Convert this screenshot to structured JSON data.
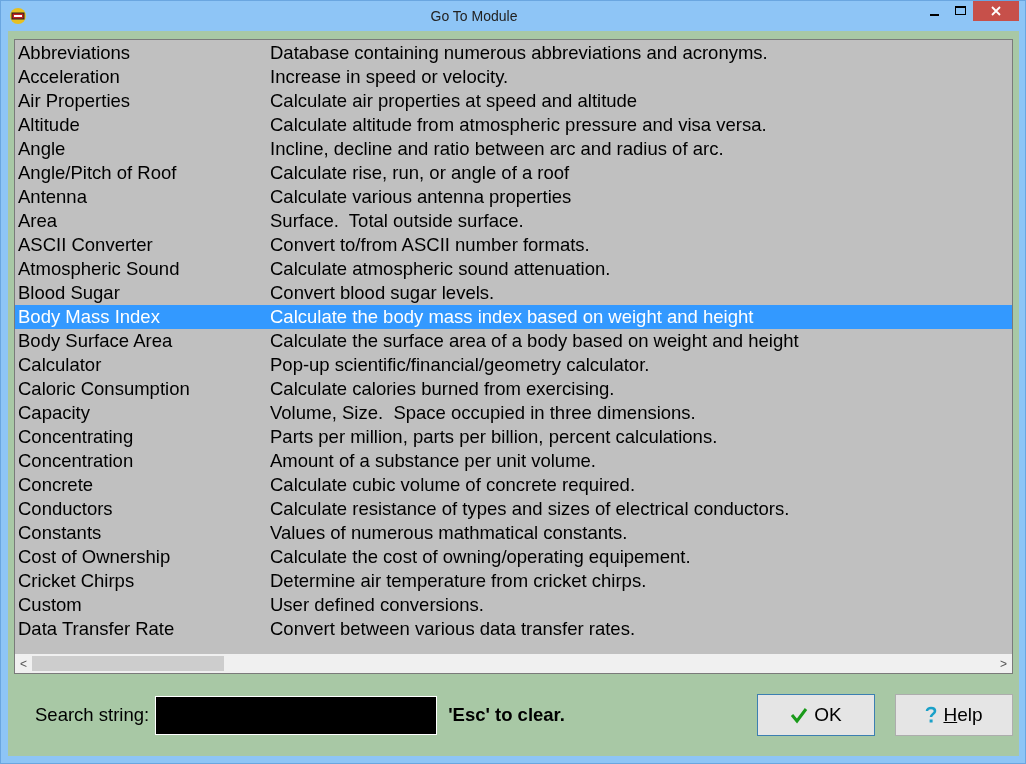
{
  "window": {
    "title": "Go To Module"
  },
  "modules": [
    {
      "name": "Abbreviations",
      "description": "Database containing numerous abbreviations and acronyms.",
      "selected": false
    },
    {
      "name": "Acceleration",
      "description": "Increase in speed or velocity.",
      "selected": false
    },
    {
      "name": "Air Properties",
      "description": "Calculate air properties at speed and altitude",
      "selected": false
    },
    {
      "name": "Altitude",
      "description": "Calculate altitude from atmospheric pressure and visa versa.",
      "selected": false
    },
    {
      "name": "Angle",
      "description": "Incline, decline and ratio between arc and radius of arc.",
      "selected": false
    },
    {
      "name": "Angle/Pitch of Roof",
      "description": "Calculate rise, run, or angle of a roof",
      "selected": false
    },
    {
      "name": "Antenna",
      "description": "Calculate various antenna properties",
      "selected": false
    },
    {
      "name": "Area",
      "description": "Surface.  Total outside surface.",
      "selected": false
    },
    {
      "name": "ASCII Converter",
      "description": "Convert to/from ASCII number formats.",
      "selected": false
    },
    {
      "name": "Atmospheric Sound",
      "description": "Calculate atmospheric sound attenuation.",
      "selected": false
    },
    {
      "name": "Blood Sugar",
      "description": "Convert blood sugar levels.",
      "selected": false
    },
    {
      "name": "Body Mass Index",
      "description": "Calculate the body mass index based on weight and height",
      "selected": true
    },
    {
      "name": "Body Surface Area",
      "description": "Calculate the surface area of a body based on weight and height",
      "selected": false
    },
    {
      "name": "Calculator",
      "description": "Pop-up scientific/financial/geometry calculator.",
      "selected": false
    },
    {
      "name": "Caloric Consumption",
      "description": "Calculate calories burned from exercising.",
      "selected": false
    },
    {
      "name": "Capacity",
      "description": "Volume, Size.  Space occupied in three dimensions.",
      "selected": false
    },
    {
      "name": "Concentrating",
      "description": "Parts per million, parts per billion, percent calculations.",
      "selected": false
    },
    {
      "name": "Concentration",
      "description": "Amount of a substance per unit volume.",
      "selected": false
    },
    {
      "name": "Concrete",
      "description": "Calculate cubic volume of concrete required.",
      "selected": false
    },
    {
      "name": "Conductors",
      "description": "Calculate resistance of types and sizes of electrical conductors.",
      "selected": false
    },
    {
      "name": "Constants",
      "description": "Values of numerous mathmatical constants.",
      "selected": false
    },
    {
      "name": "Cost of Ownership",
      "description": "Calculate the cost of owning/operating equipement.",
      "selected": false
    },
    {
      "name": "Cricket Chirps",
      "description": "Determine air temperature from cricket chirps.",
      "selected": false
    },
    {
      "name": "Custom",
      "description": "User defined conversions.",
      "selected": false
    },
    {
      "name": "Data Transfer Rate",
      "description": "Convert between various data transfer rates.",
      "selected": false
    }
  ],
  "scroll_left": "<",
  "scroll_right": ">",
  "search": {
    "label": "Search string:",
    "hint": "'Esc' to clear."
  },
  "buttons": [
    {
      "kind": "ok",
      "label": "OK",
      "focused": true
    },
    {
      "kind": "help",
      "label": "Help",
      "focused": false
    }
  ]
}
